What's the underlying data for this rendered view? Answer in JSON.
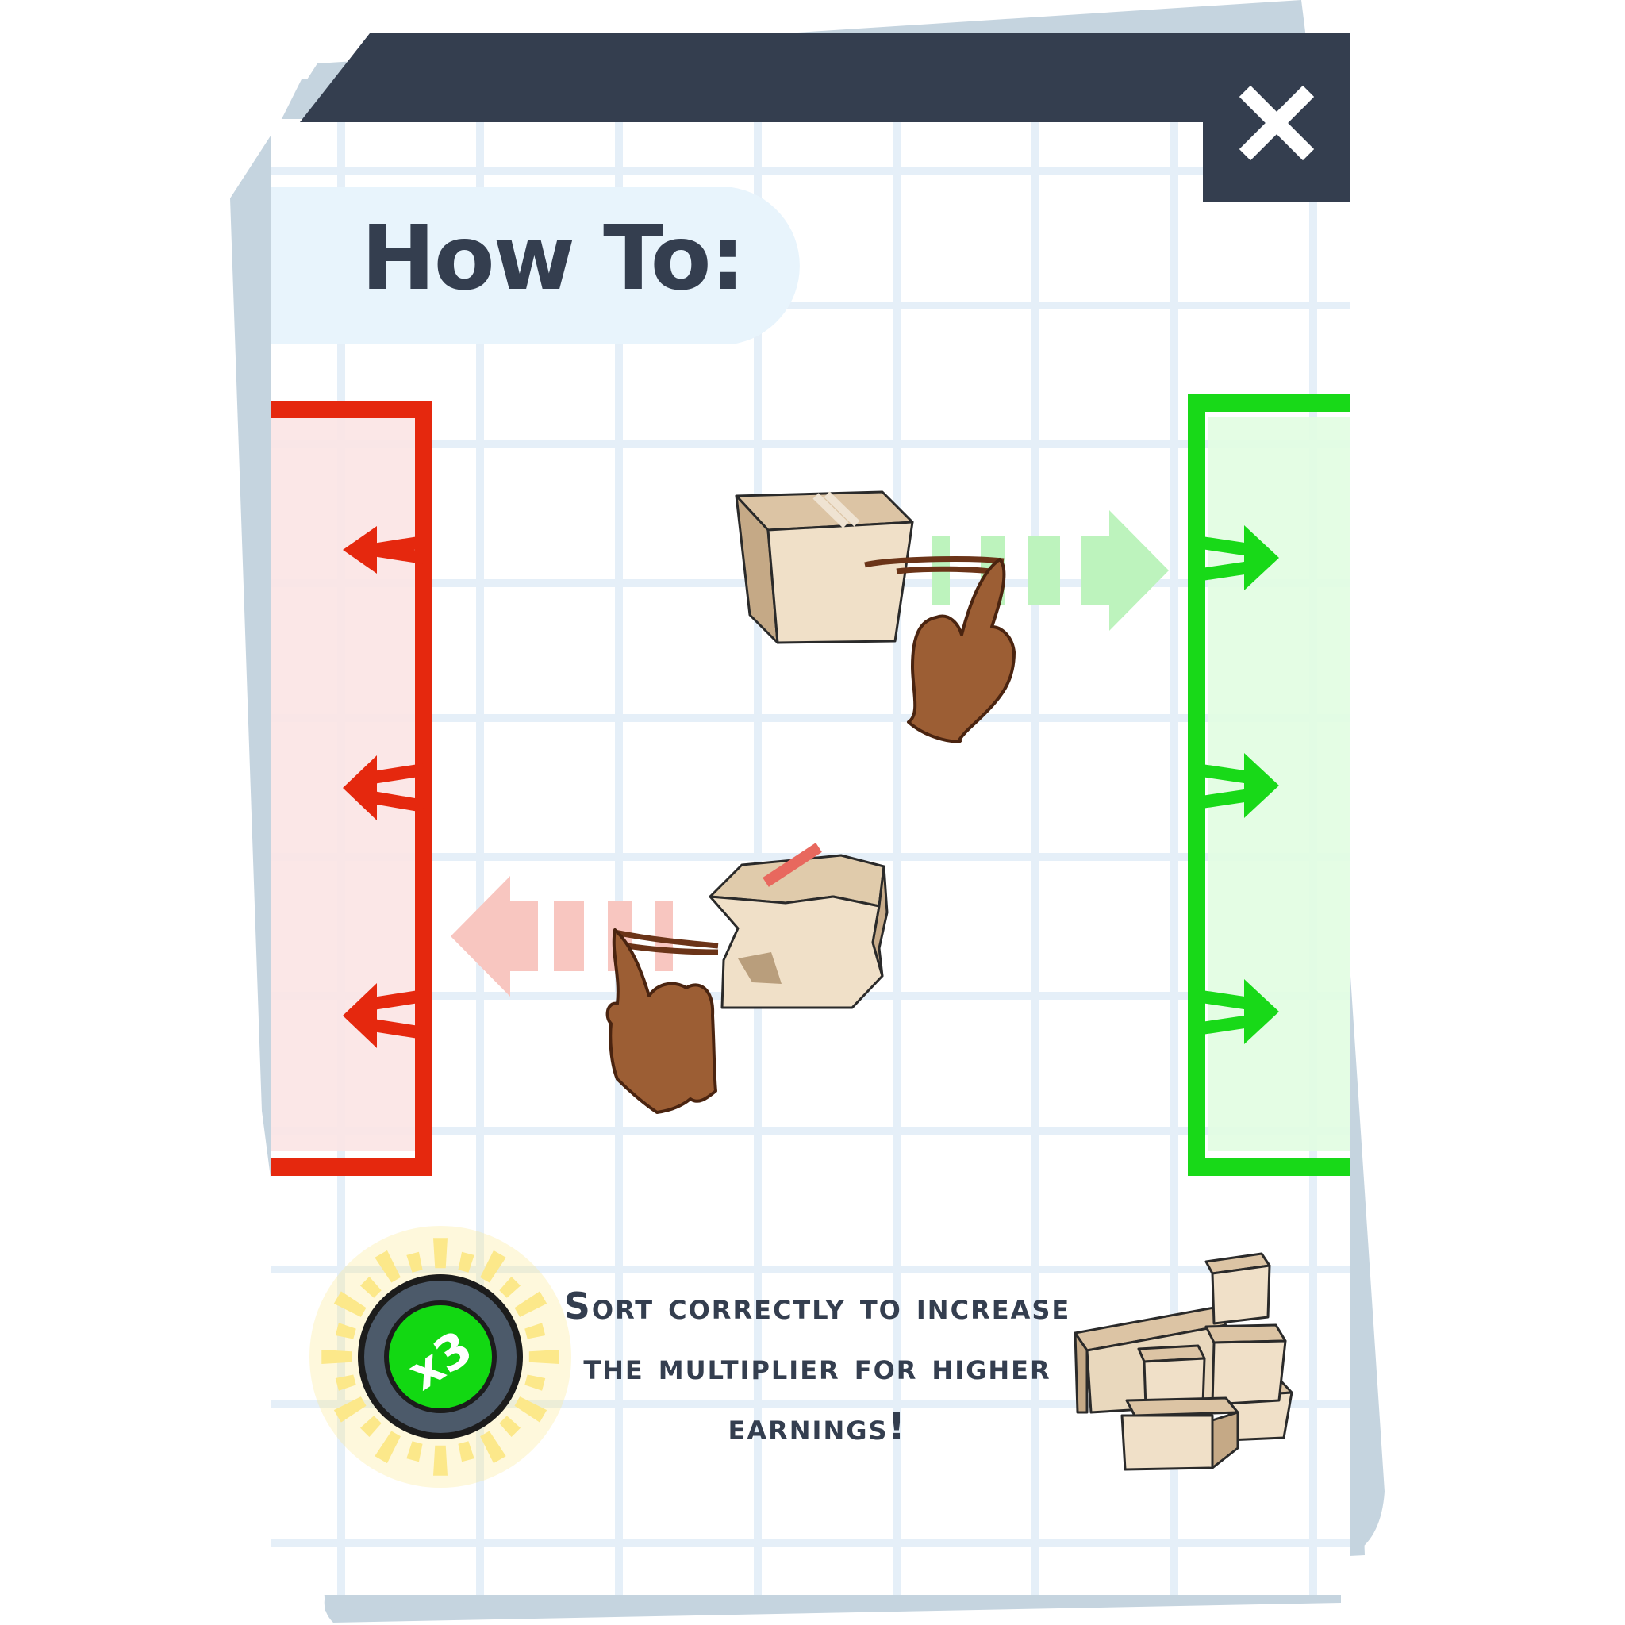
{
  "title": "How To:",
  "hint_text": "Sort correctly to increase the multiplier for higher earnings!",
  "multiplier": "x3",
  "icons": {
    "close": "close-icon",
    "bad_zone": "reject-bin-icon",
    "good_zone": "accept-bin-icon"
  },
  "colors": {
    "header": "#343e4f",
    "paper_shadow": "#c5d4df",
    "grid_line": "#e5eff8",
    "title_pill": "#e8f4fc",
    "reject_red": "#e5280e",
    "reject_fill": "#fbe4e4",
    "accept_green": "#18d918",
    "accept_fill": "#e1fde1",
    "hand_skin": "#9c5e34",
    "box_light": "#f0e0c8",
    "box_dark": "#c9ad8b",
    "multiplier_green": "#12d812",
    "burst_yellow": "#fde98a"
  }
}
